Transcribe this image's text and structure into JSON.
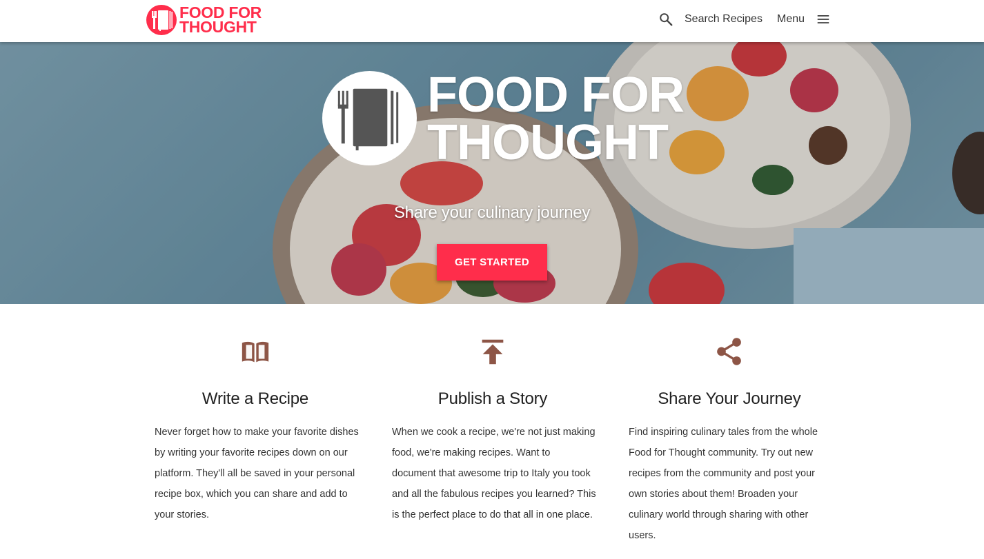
{
  "header": {
    "brand_line1": "FOOD FOR",
    "brand_line2": "THOUGHT",
    "search_label": "Search Recipes",
    "menu_label": "Menu"
  },
  "hero": {
    "title_line1": "FOOD FOR",
    "title_line2": "THOUGHT",
    "tagline": "Share your culinary journey",
    "cta_label": "GET STARTED"
  },
  "features": [
    {
      "icon": "open-book-icon",
      "title": "Write a Recipe",
      "text": "Never forget how to make your favorite dishes by writing your favorite recipes down on our platform. They'll all be saved in your personal recipe box, which you can share and add to your stories."
    },
    {
      "icon": "publish-upload-icon",
      "title": "Publish a Story",
      "text": "When we cook a recipe, we're not just making food, we're making recipes. Want to document that awesome trip to Italy you took and all the fabulous recipes you learned? This is the perfect place to do that all in one place."
    },
    {
      "icon": "share-icon",
      "title": "Share Your Journey",
      "text": "Find inspiring culinary tales from the whole Food for Thought community. Try out new recipes from the community and post your own stories about them! Broaden your culinary world through sharing with other users."
    }
  ],
  "colors": {
    "brand": "#ff2d4b",
    "icon": "#8d5546",
    "text": "#333333"
  }
}
